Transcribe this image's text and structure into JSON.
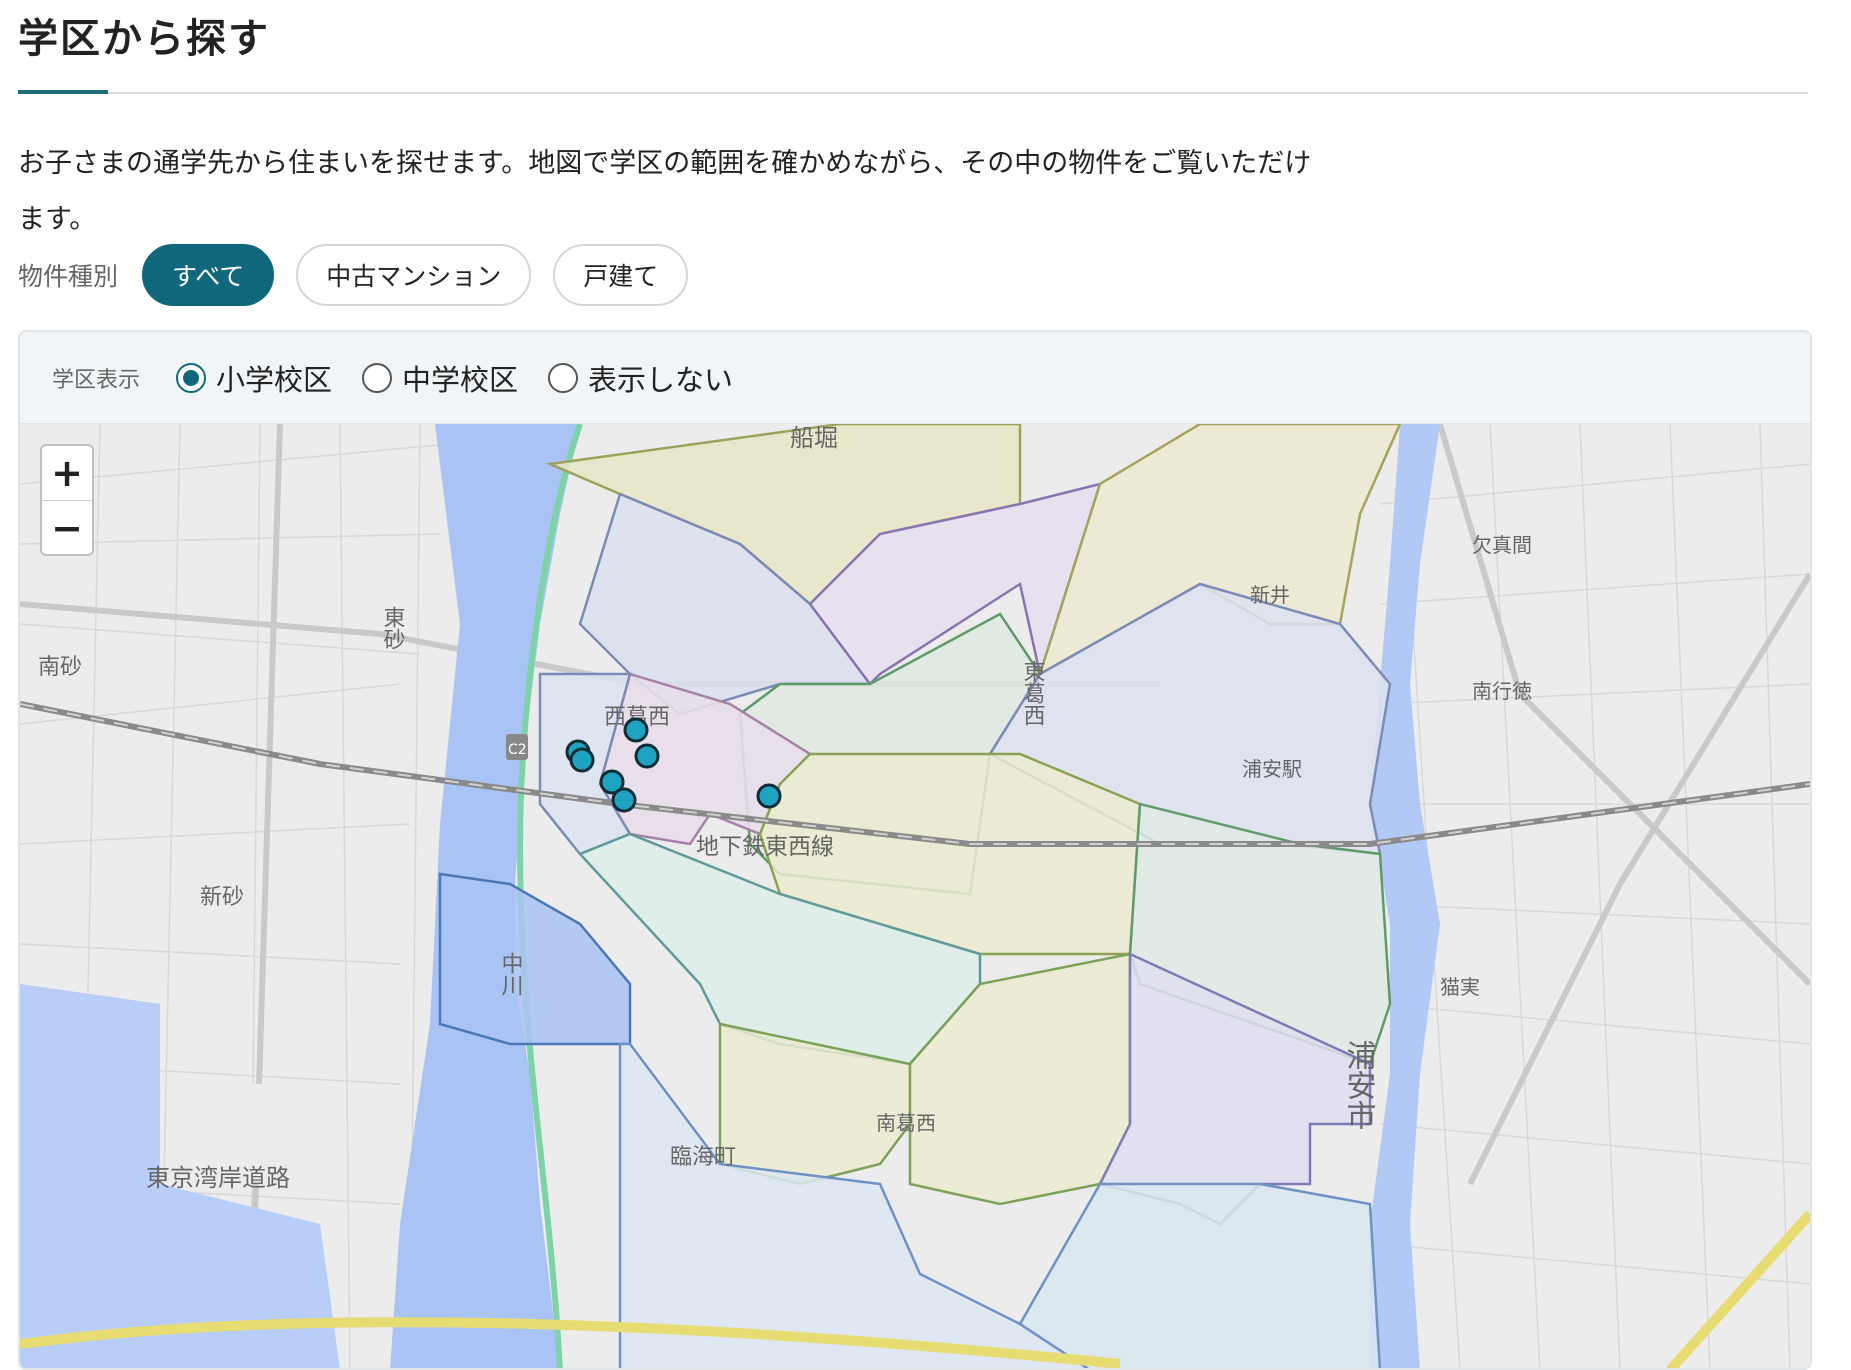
{
  "header": {
    "title": "学区から探す"
  },
  "description": "お子さまの通学先から住まいを探せます。地図で学区の範囲を確かめながら、その中の物件をご覧いただけます。",
  "property_filter": {
    "label": "物件種別",
    "options": [
      {
        "label": "すべて",
        "selected": true
      },
      {
        "label": "中古マンション",
        "selected": false
      },
      {
        "label": "戸建て",
        "selected": false
      }
    ]
  },
  "school_zone": {
    "label": "学区表示",
    "options": [
      {
        "label": "小学校区",
        "selected": true
      },
      {
        "label": "中学校区",
        "selected": false
      },
      {
        "label": "表示しない",
        "selected": false
      }
    ]
  },
  "map": {
    "zoom_in_label": "+",
    "zoom_out_label": "−",
    "place_labels": {
      "funabori": "船堀",
      "higashisuna": "東砂",
      "minamisuna": "南砂",
      "nishikasai": "西葛西",
      "higashikasai": "東葛西",
      "shinsuna": "新砂",
      "nakagawa": "中川",
      "tozai_line": "地下鉄東西線",
      "rinkai": "臨海町",
      "minamikasai": "南葛西",
      "wangan": "東京湾岸道路",
      "kyumama": "欠真間",
      "arai": "新井",
      "minamigyotoku": "南行徳",
      "urayasu_station": "浦安駅",
      "nekozane": "猫実",
      "urayasu_city": "浦安市",
      "c2": "C2"
    },
    "accent_color": "#11687c",
    "marker_color": "#1ea3c2"
  }
}
